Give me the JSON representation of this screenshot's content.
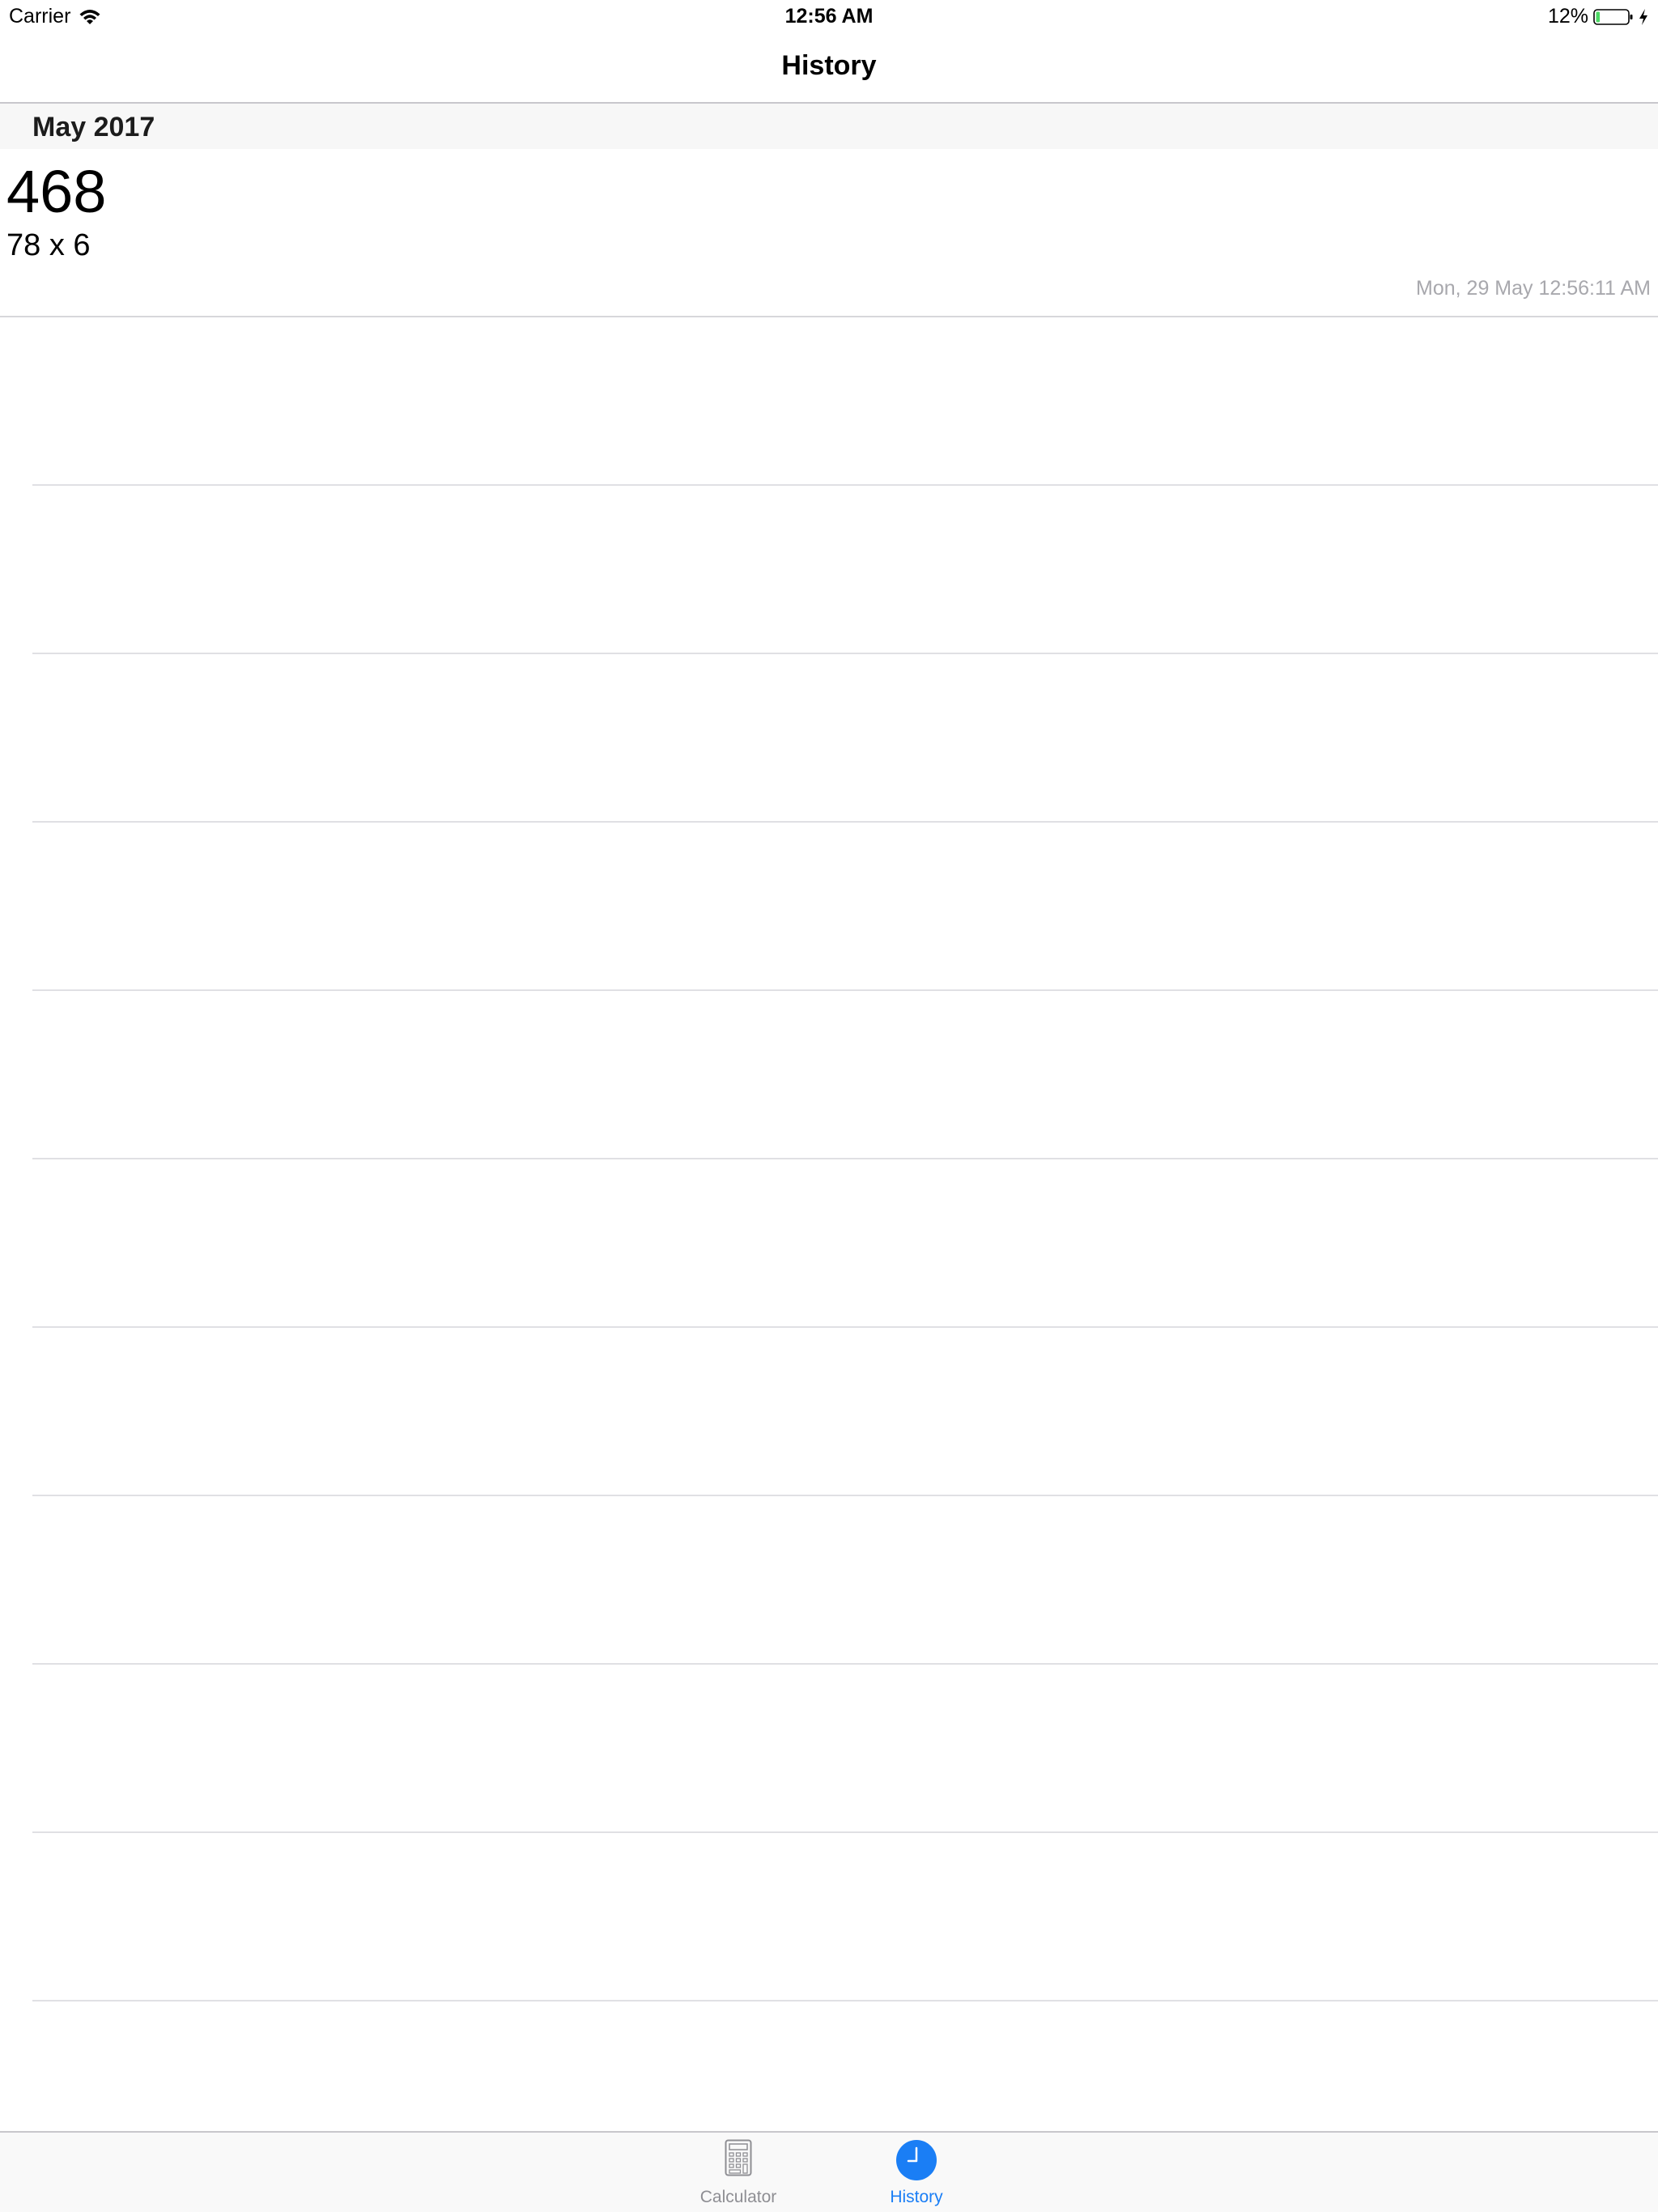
{
  "status_bar": {
    "carrier": "Carrier",
    "time": "12:56 AM",
    "battery_percent": "12%",
    "battery_level": 0.12,
    "icons": [
      "wifi-icon",
      "battery-icon",
      "charging-bolt-icon"
    ]
  },
  "nav": {
    "title": "History"
  },
  "history": {
    "sections": [
      {
        "title": "May 2017",
        "entries": [
          {
            "result": "468",
            "expression": "78 x 6",
            "timestamp": "Mon, 29 May 12:56:11 AM"
          }
        ]
      }
    ]
  },
  "tab_bar": {
    "tabs": [
      {
        "label": "Calculator",
        "icon": "calculator-icon",
        "selected": false
      },
      {
        "label": "History",
        "icon": "clock-icon",
        "selected": true
      }
    ],
    "active_color": "#1a7ef5",
    "inactive_color": "#8e8e93"
  }
}
